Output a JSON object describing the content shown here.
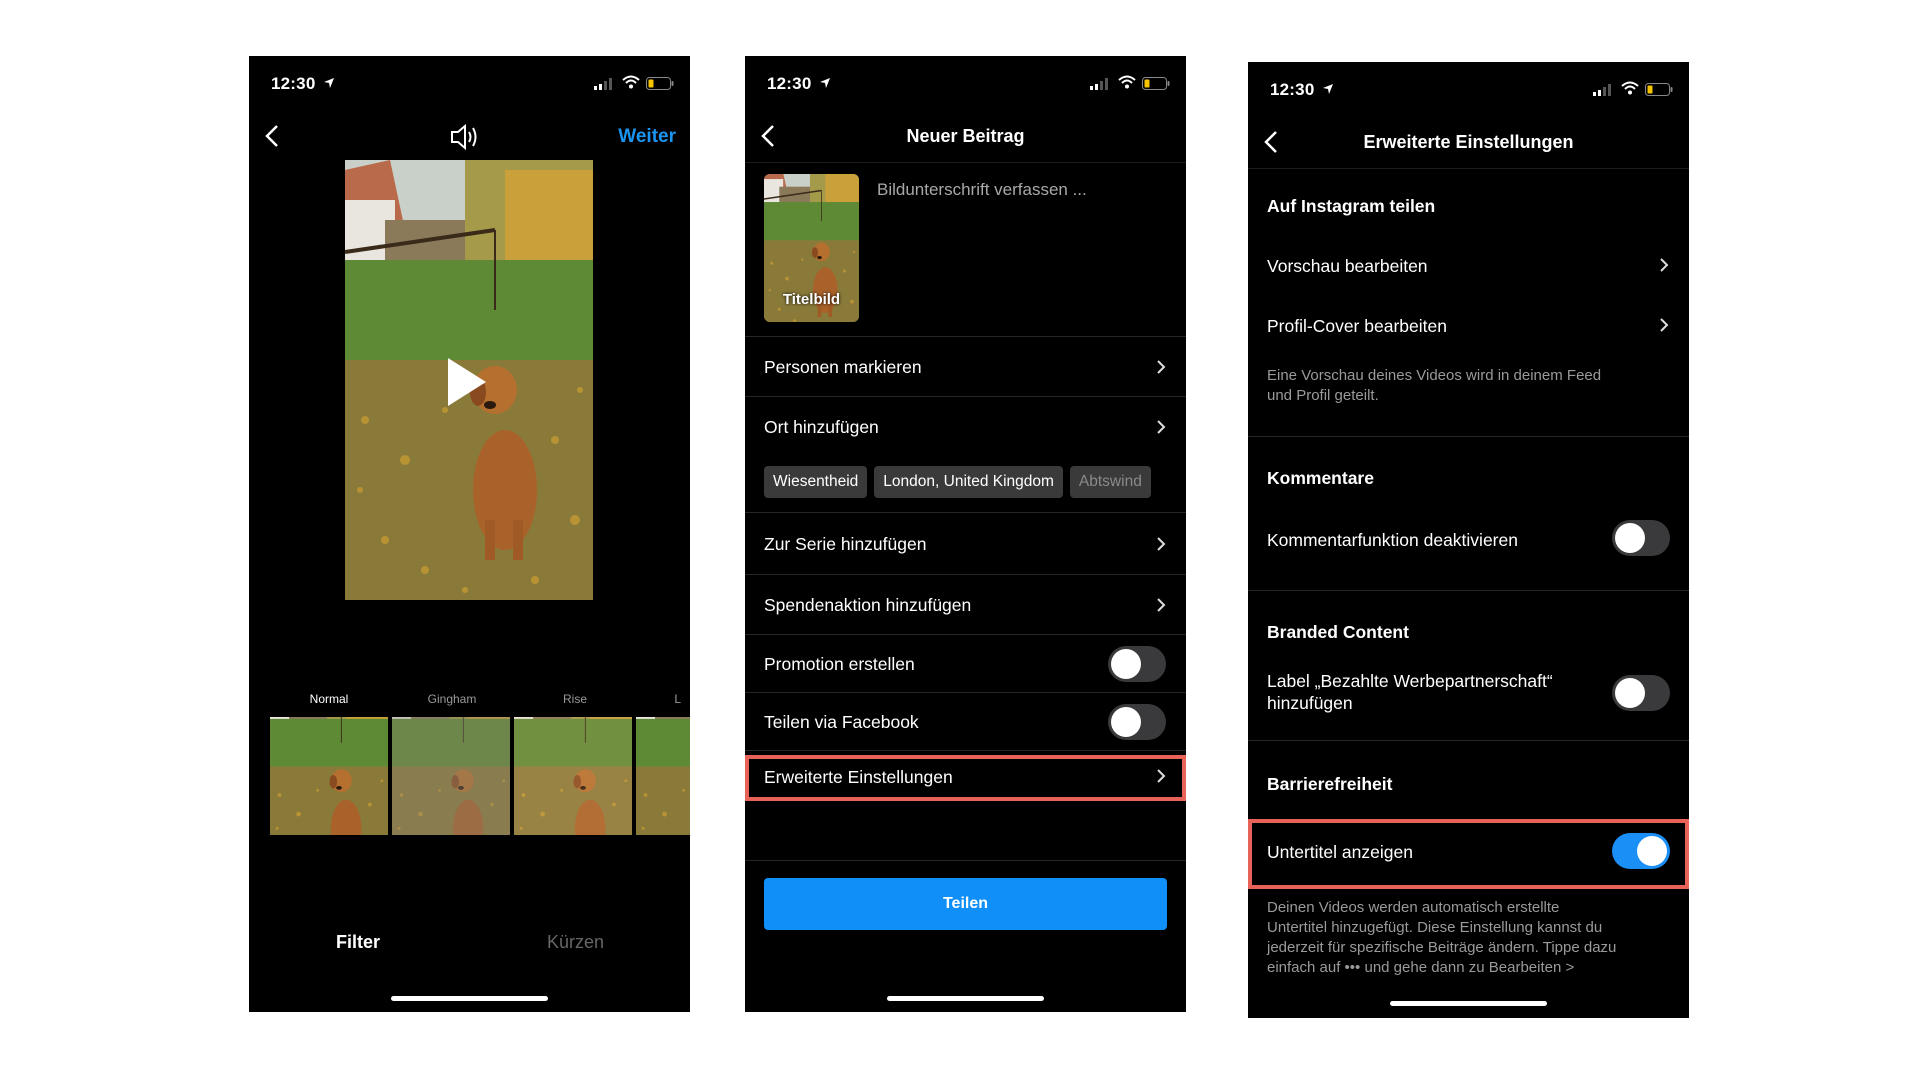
{
  "status": {
    "time": "12:30"
  },
  "phone1": {
    "weiter": "Weiter",
    "filters": [
      "Normal",
      "Gingham",
      "Rise",
      "L"
    ],
    "tabs": {
      "filter": "Filter",
      "kuerzen": "Kürzen"
    }
  },
  "phone2": {
    "title": "Neuer Beitrag",
    "cover_label": "Titelbild",
    "caption_placeholder": "Bildunterschrift verfassen ...",
    "rows": {
      "personen": "Personen markieren",
      "ort": "Ort hinzufügen",
      "serie": "Zur Serie hinzufügen",
      "spenden": "Spendenaktion hinzufügen",
      "promotion": "Promotion erstellen",
      "facebook": "Teilen via Facebook",
      "erweitert": "Erweiterte Einstellungen"
    },
    "location_chips": [
      "Wiesentheid",
      "London, United Kingdom",
      "Abtswind"
    ],
    "share_button": "Teilen"
  },
  "phone3": {
    "title": "Erweiterte Einstellungen",
    "sections": {
      "instagram": "Auf Instagram teilen",
      "kommentare": "Kommentare",
      "branded": "Branded Content",
      "barriere": "Barrierefreiheit"
    },
    "rows": {
      "vorschau": "Vorschau bearbeiten",
      "profil_cover": "Profil-Cover bearbeiten",
      "kommentarfunktion": "Kommentarfunktion deaktivieren",
      "label_line1": "Label „Bezahlte Werbepartnerschaft“",
      "label_line2": "hinzufügen",
      "untertitel": "Untertitel anzeigen"
    },
    "notes": {
      "vorschau_line1": "Eine Vorschau deines Videos wird in deinem Feed",
      "vorschau_line2": "und Profil geteilt.",
      "untertitel_line1": "Deinen Videos werden automatisch erstellte",
      "untertitel_line2": "Untertitel hinzugefügt. Diese Einstellung kannst du",
      "untertitel_line3": "jederzeit für spezifische Beiträge ändern. Tippe dazu",
      "untertitel_line4": "einfach auf ••• und gehe dann zu Bearbeiten >"
    },
    "toggles": {
      "kommentarfunktion": false,
      "werbepartnerschaft": false,
      "untertitel": true
    }
  },
  "colors": {
    "accent_blue": "#0f8ff7",
    "highlight_red": "#e86258",
    "background": "#000000"
  }
}
